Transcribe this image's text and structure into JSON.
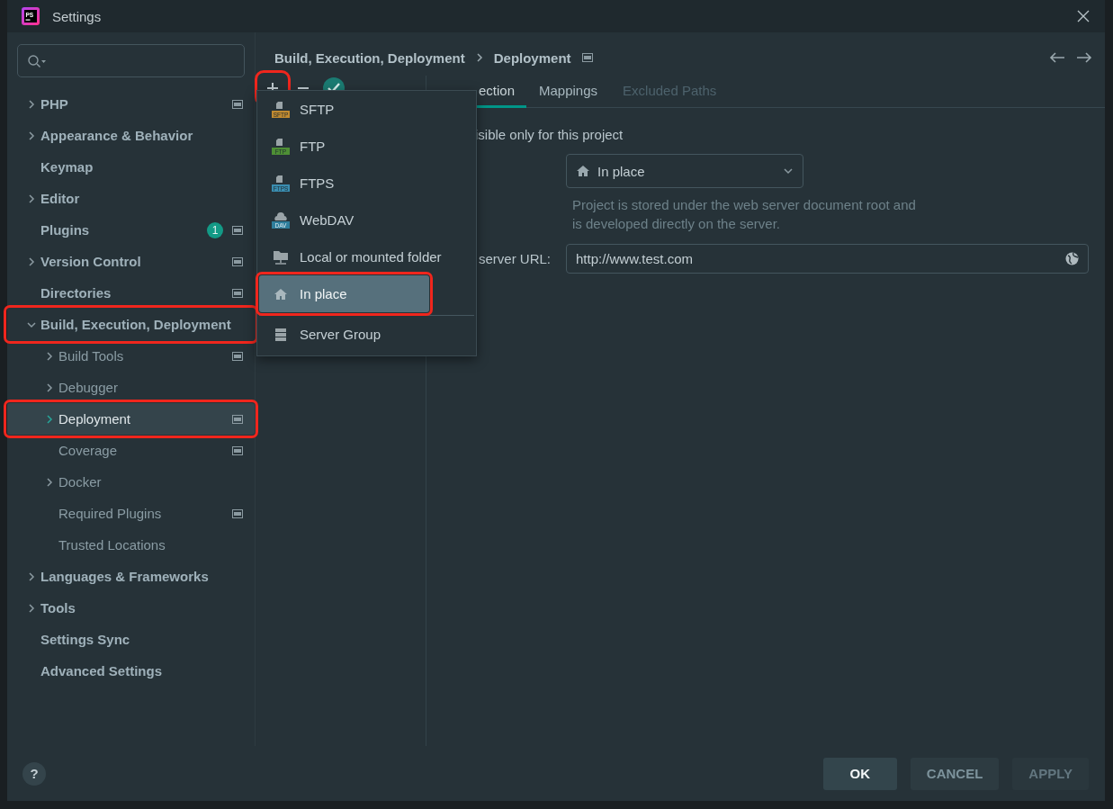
{
  "window": {
    "title": "Settings",
    "app_icon_text": "PS"
  },
  "sidebar": {
    "items": [
      {
        "label": "PHP",
        "kind": "folder",
        "expanded": false,
        "scope_icon": true,
        "selected": false,
        "highlighted": false
      },
      {
        "label": "Appearance & Behavior",
        "kind": "folder",
        "expanded": false,
        "scope_icon": false,
        "selected": false,
        "highlighted": false
      },
      {
        "label": "Keymap",
        "kind": "leaf",
        "scope_icon": false,
        "selected": false,
        "highlighted": false
      },
      {
        "label": "Editor",
        "kind": "folder",
        "expanded": false,
        "scope_icon": false,
        "selected": false,
        "highlighted": false
      },
      {
        "label": "Plugins",
        "kind": "leaf",
        "badge": "1",
        "scope_icon": true,
        "selected": false,
        "highlighted": false
      },
      {
        "label": "Version Control",
        "kind": "folder",
        "expanded": false,
        "scope_icon": true,
        "selected": false,
        "highlighted": false
      },
      {
        "label": "Directories",
        "kind": "leaf",
        "scope_icon": true,
        "selected": false,
        "highlighted": false
      },
      {
        "label": "Build, Execution, Deployment",
        "kind": "folder",
        "expanded": true,
        "scope_icon": false,
        "selected": false,
        "highlighted": true,
        "children": [
          {
            "label": "Build Tools",
            "kind": "folder",
            "expanded": false,
            "scope_icon": true,
            "selected": false,
            "highlighted": false
          },
          {
            "label": "Debugger",
            "kind": "folder",
            "expanded": false,
            "scope_icon": false,
            "selected": false,
            "highlighted": false
          },
          {
            "label": "Deployment",
            "kind": "folder",
            "expanded": false,
            "scope_icon": true,
            "selected": true,
            "highlighted": true
          },
          {
            "label": "Coverage",
            "kind": "leaf",
            "scope_icon": true,
            "selected": false,
            "highlighted": false
          },
          {
            "label": "Docker",
            "kind": "folder",
            "expanded": false,
            "scope_icon": false,
            "selected": false,
            "highlighted": false
          },
          {
            "label": "Required Plugins",
            "kind": "leaf",
            "scope_icon": true,
            "selected": false,
            "highlighted": false
          },
          {
            "label": "Trusted Locations",
            "kind": "leaf",
            "scope_icon": false,
            "selected": false,
            "highlighted": false
          }
        ]
      },
      {
        "label": "Languages & Frameworks",
        "kind": "folder",
        "expanded": false,
        "scope_icon": false,
        "selected": false,
        "highlighted": false
      },
      {
        "label": "Tools",
        "kind": "folder",
        "expanded": false,
        "scope_icon": false,
        "selected": false,
        "highlighted": false
      },
      {
        "label": "Settings Sync",
        "kind": "leaf",
        "scope_icon": false,
        "selected": false,
        "highlighted": false
      },
      {
        "label": "Advanced Settings",
        "kind": "leaf",
        "scope_icon": false,
        "selected": false,
        "highlighted": false
      }
    ]
  },
  "breadcrumb": {
    "path": [
      "Build, Execution, Deployment",
      "Deployment"
    ]
  },
  "toolbar": {
    "buttons": [
      {
        "kind": "add",
        "highlighted": true
      },
      {
        "kind": "remove"
      },
      {
        "kind": "default"
      }
    ]
  },
  "add_menu": {
    "items": [
      {
        "kind": "protocol",
        "label": "SFTP",
        "tag": "SFTP",
        "color": "#c08a30",
        "selected": false,
        "highlighted": false
      },
      {
        "kind": "protocol",
        "label": "FTP",
        "tag": "FTP",
        "color": "#4e8f35",
        "selected": false,
        "highlighted": false
      },
      {
        "kind": "protocol",
        "label": "FTPS",
        "tag": "FTPS",
        "color": "#3a8db0",
        "selected": false,
        "highlighted": false
      },
      {
        "kind": "cloud",
        "label": "WebDAV",
        "tag": "DAV",
        "color": "#2f7e9c",
        "selected": false,
        "highlighted": false
      },
      {
        "kind": "folder",
        "label": "Local or mounted folder",
        "selected": false,
        "highlighted": false
      },
      {
        "kind": "house",
        "label": "In place",
        "selected": true,
        "highlighted": true
      },
      {
        "kind": "separator"
      },
      {
        "kind": "servers",
        "label": "Server Group",
        "selected": false,
        "highlighted": false
      }
    ]
  },
  "tabs": [
    {
      "label": "ection",
      "selected": true,
      "disabled": false
    },
    {
      "label": "Mappings",
      "selected": false,
      "disabled": false
    },
    {
      "label": "Excluded Paths",
      "selected": false,
      "disabled": true
    }
  ],
  "form": {
    "visible_only": {
      "label": "isible only for this project"
    },
    "type": {
      "value": "In place"
    },
    "hint": "Project is stored under the web server document root and\nis developed directly on the server.",
    "url": {
      "label": "server URL:",
      "value": "http://www.test.com"
    }
  },
  "footer": {
    "help": "?",
    "buttons": [
      {
        "label": "OK",
        "kind": "primary",
        "disabled": false
      },
      {
        "label": "CANCEL",
        "kind": "normal",
        "disabled": false
      },
      {
        "label": "APPLY",
        "kind": "normal",
        "disabled": true
      }
    ]
  }
}
